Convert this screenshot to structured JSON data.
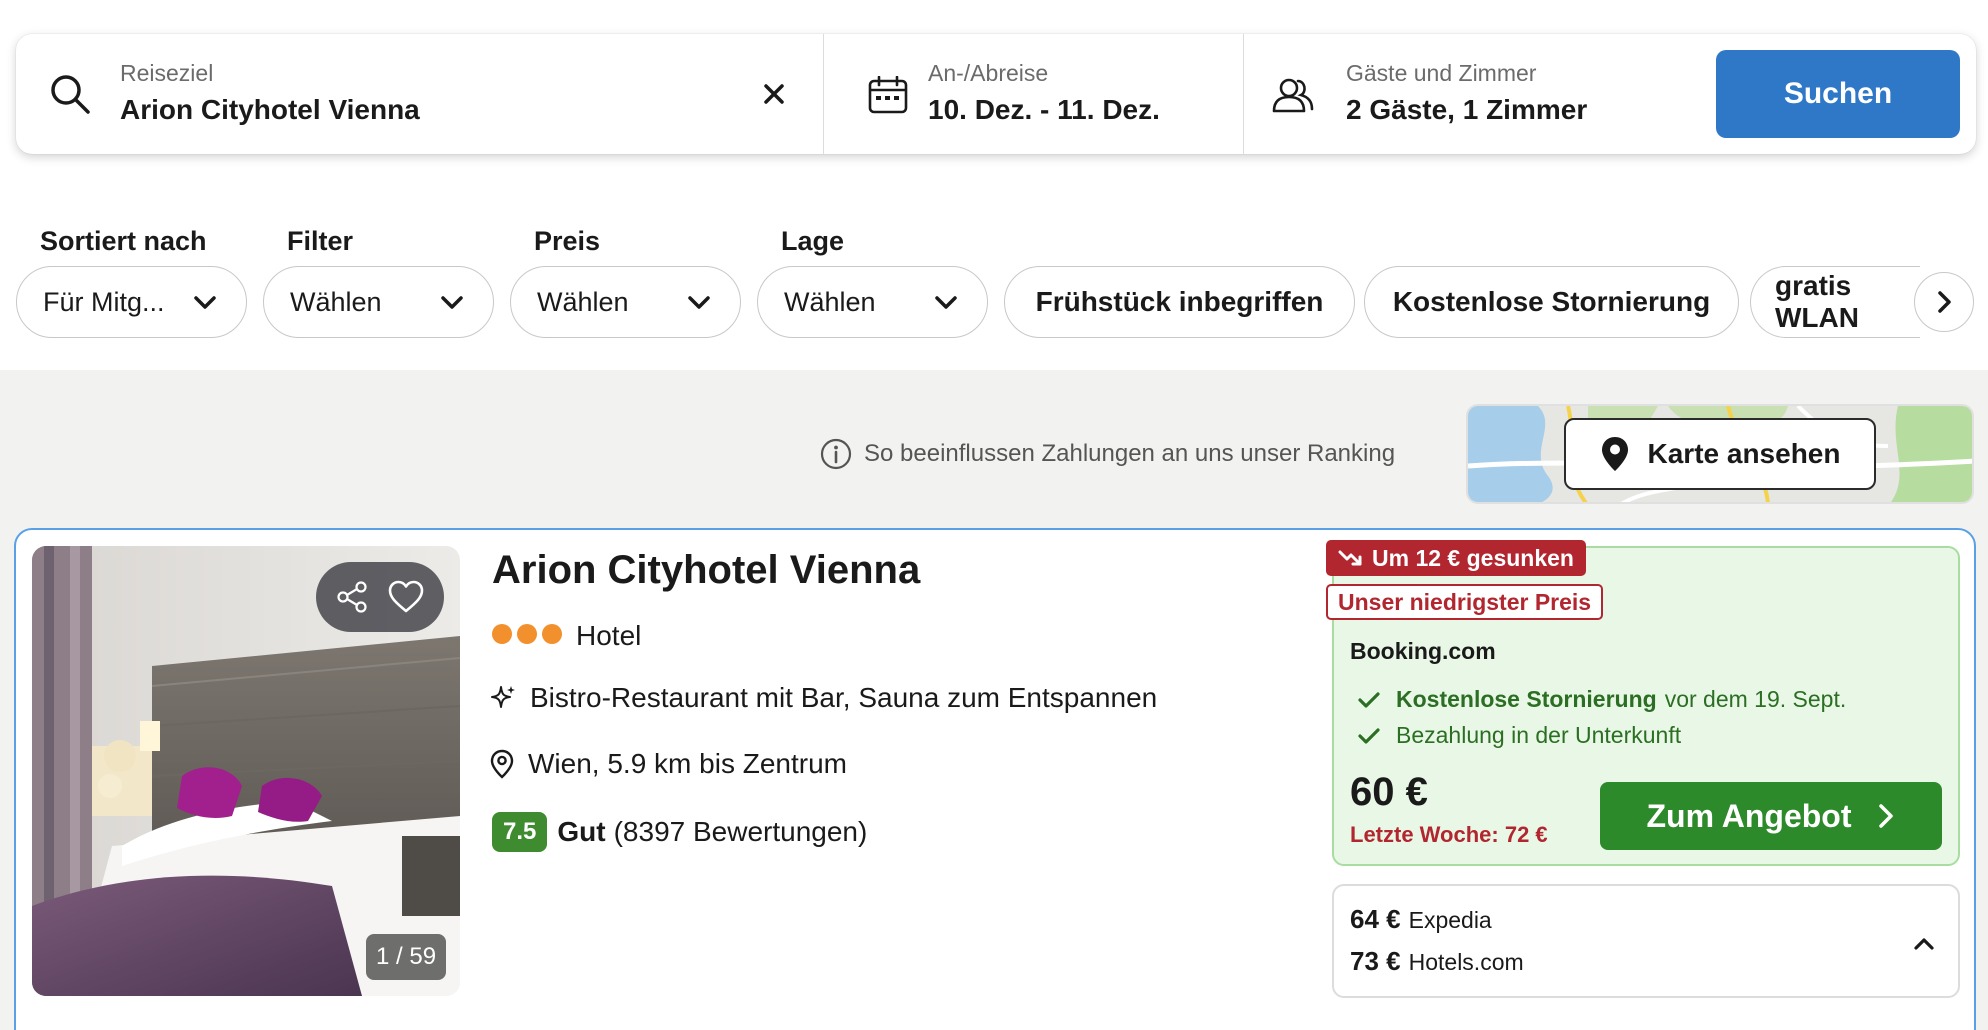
{
  "search": {
    "destination_label": "Reiseziel",
    "destination_value": "Arion Cityhotel Vienna",
    "dates_label": "An-/Abreise",
    "dates_value": "10. Dez. - 11. Dez.",
    "guests_label": "Gäste und Zimmer",
    "guests_value": "2 Gäste, 1 Zimmer",
    "button_label": "Suchen"
  },
  "filters": {
    "sort_label": "Sortiert nach",
    "sort_value": "Für Mitg...",
    "filter_label": "Filter",
    "filter_value": "Wählen",
    "price_label": "Preis",
    "price_value": "Wählen",
    "location_label": "Lage",
    "location_value": "Wählen",
    "chips": [
      "Frühstück inbegriffen",
      "Kostenlose Stornierung",
      "gratis WLAN"
    ]
  },
  "info": {
    "ranking_text": "So beeinflussen Zahlungen an uns unser Ranking",
    "map_button": "Karte ansehen"
  },
  "hotel": {
    "name": "Arion Cityhotel Vienna",
    "star_count": 3,
    "type": "Hotel",
    "highlight": "Bistro-Restaurant mit Bar, Sauna zum Entspannen",
    "location": "Wien, 5.9 km bis Zentrum",
    "rating_score": "7.5",
    "rating_word": "Gut",
    "rating_count": "(8397 Bewertungen)",
    "photo_counter": "1 / 59"
  },
  "offer": {
    "price_drop_badge": "Um 12 € gesunken",
    "lowest_badge": "Unser niedrigster Preis",
    "provider": "Booking.com",
    "perk1_bold": "Kostenlose Stornierung",
    "perk1_rest": "vor dem 19. Sept.",
    "perk2": "Bezahlung in der Unterkunft",
    "price": "60 €",
    "last_week": "Letzte Woche: 72 €",
    "button": "Zum Angebot"
  },
  "other_offers": [
    {
      "price": "64 €",
      "provider": "Expedia"
    },
    {
      "price": "73 €",
      "provider": "Hotels.com"
    }
  ],
  "colors": {
    "primary_blue": "#2f78c7",
    "deal_green": "#2c8a2a",
    "deal_red": "#b1262f",
    "star_orange": "#f3902e",
    "rating_green": "#3e8c2f"
  }
}
